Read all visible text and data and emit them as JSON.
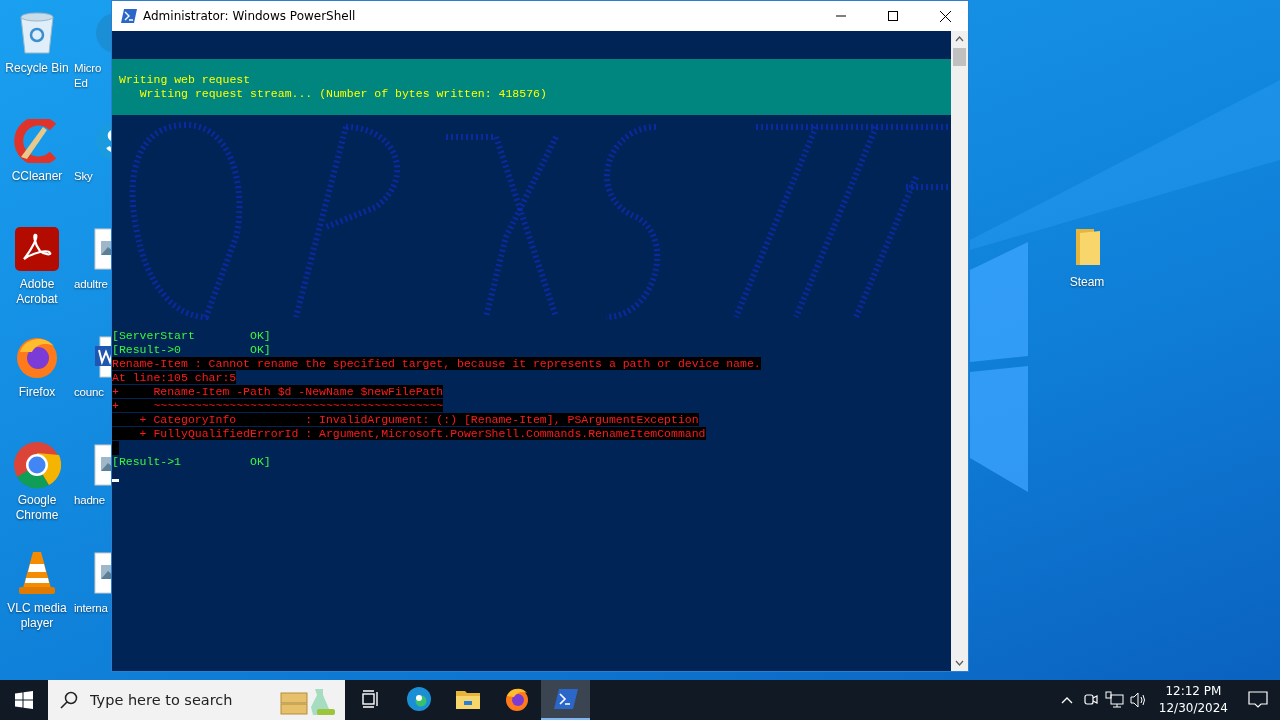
{
  "desktop_icons": [
    {
      "kind": "recycle-bin",
      "lines": [
        "Recycle Bin"
      ]
    },
    {
      "kind": "ccleaner",
      "lines": [
        "CCleaner"
      ]
    },
    {
      "kind": "acrobat",
      "lines": [
        "Adobe",
        "Acrobat"
      ]
    },
    {
      "kind": "firefox",
      "lines": [
        "Firefox"
      ]
    },
    {
      "kind": "chrome",
      "lines": [
        "Google",
        "Chrome"
      ]
    },
    {
      "kind": "vlc",
      "lines": [
        "VLC media",
        "player"
      ]
    }
  ],
  "desktop_icons_partly_covered": [
    {
      "kind": "edge",
      "lines": [
        "Micro",
        "Ed"
      ]
    },
    {
      "kind": "skype",
      "lines": [
        "Sky"
      ]
    },
    {
      "kind": "image-file",
      "lines": [
        "adultre"
      ]
    },
    {
      "kind": "word-file",
      "lines": [
        "counc"
      ]
    },
    {
      "kind": "image-file",
      "lines": [
        "hadne"
      ]
    },
    {
      "kind": "image-file",
      "lines": [
        "interna"
      ]
    }
  ],
  "desktop_icons_right": [
    {
      "kind": "folder",
      "lines": [
        "Steam"
      ]
    }
  ],
  "window": {
    "title": "Administrator: Windows PowerShell",
    "progress": {
      "activity": "Writing web request",
      "status": "Writing request stream... (Number of bytes written: 418576)"
    },
    "lines": [
      {
        "kind": "ok",
        "text": "[ServerStart        OK]"
      },
      {
        "kind": "ok",
        "text": "[Result->0          OK]"
      },
      {
        "kind": "error",
        "text": "Rename-Item : Cannot rename the specified target, because it represents a path or device name."
      },
      {
        "kind": "error",
        "text": "At line:105 char:5"
      },
      {
        "kind": "error",
        "text": "+     Rename-Item -Path $d -NewName $newFilePath"
      },
      {
        "kind": "error",
        "text": "+     ~~~~~~~~~~~~~~~~~~~~~~~~~~~~~~~~~~~~~~~~~~"
      },
      {
        "kind": "error",
        "text": "    + CategoryInfo          : InvalidArgument: (:) [Rename-Item], PSArgumentException"
      },
      {
        "kind": "error",
        "text": "    + FullyQualifiedErrorId : Argument,Microsoft.PowerShell.Commands.RenameItemCommand"
      },
      {
        "kind": "error-gap"
      },
      {
        "kind": "ok",
        "text": "[Result->1          OK]"
      },
      {
        "kind": "cursor"
      }
    ]
  },
  "taskbar": {
    "search": {
      "placeholder": "Type here to search"
    },
    "apps": [
      {
        "kind": "task-view",
        "selected": false
      },
      {
        "kind": "edge",
        "selected": false
      },
      {
        "kind": "explorer",
        "selected": false
      },
      {
        "kind": "firefox",
        "selected": false
      },
      {
        "kind": "powershell",
        "selected": true
      }
    ],
    "clock": {
      "time": "12:12 PM",
      "date": "12/30/2024"
    }
  }
}
